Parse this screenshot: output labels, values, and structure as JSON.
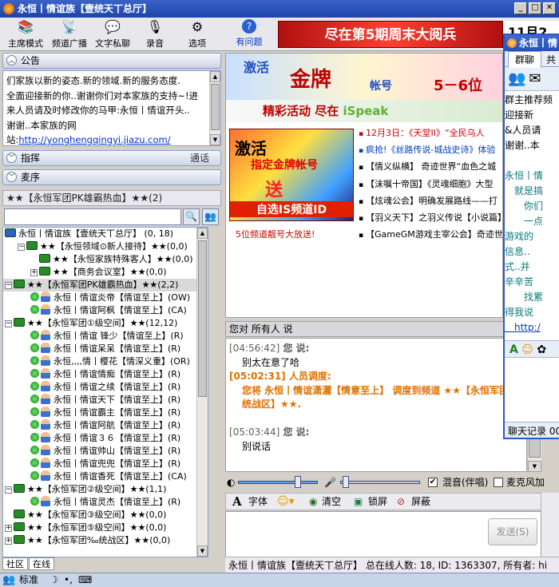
{
  "window": {
    "title": "永恒丨情谊族【壹统天丅总厅】"
  },
  "toolbar": {
    "items": [
      {
        "label": "主席模式",
        "icon": "chair-icon"
      },
      {
        "label": "频道广播",
        "icon": "broadcast-icon"
      },
      {
        "label": "文字私聊",
        "icon": "private-chat-icon"
      },
      {
        "label": "录音",
        "icon": "record-icon"
      },
      {
        "label": "选项",
        "icon": "gear-icon"
      },
      {
        "label": "有问题",
        "icon": "help-icon"
      }
    ]
  },
  "banner_top": {
    "text": "尽在第5期周末大阅兵",
    "date": "11月2"
  },
  "notice": {
    "header": "公告",
    "lines": [
      "们家族以新的姿态.新的领域.新的服务态度.",
      "全面迎接新的你..谢谢你们对本家族的支持~!进",
      "来人员请及时修改你的马甲:永恒丨情谊开头..",
      "谢谢..本家族的网"
    ],
    "site_label": "站:",
    "url": "http://yonghengqingyi.jiazu.com/"
  },
  "panels": {
    "guide": "指挥",
    "guide_right": "通话",
    "wheat": "麦序"
  },
  "channel_title": "★★【永恒军团PK雄霸热血】★★(2)",
  "tree": [
    {
      "t": "永恒丨情谊族【壹统天丅总厅】 (0, 18)",
      "type": "root",
      "indent": 0,
      "exp": ""
    },
    {
      "t": "★★【永恒领域⊙新人接待】★★(0,0)",
      "type": "chan",
      "indent": 1,
      "exp": "−"
    },
    {
      "t": "★★【永恒家族特殊客人】★★(0,0)",
      "type": "chan",
      "indent": 2,
      "exp": ""
    },
    {
      "t": "★★【商务会议室】★★(0,0)",
      "type": "chan",
      "indent": 2,
      "exp": "+"
    },
    {
      "t": "★★【永恒军团PK雄霸热血】★★(2,2)",
      "type": "chan",
      "indent": 0,
      "exp": "−",
      "sel": true
    },
    {
      "t": "永恒丨情谊炎帝【情谊至上】(OW)",
      "type": "user",
      "indent": 2
    },
    {
      "t": "永恒丨情谊阿枫【情谊至上】(CA)",
      "type": "user",
      "indent": 2
    },
    {
      "t": "★★【永恒军团①级空间】★★(12,12)",
      "type": "chan",
      "indent": 0,
      "exp": "−"
    },
    {
      "t": "永恒丨情谊 锋少【情谊至上】(R)",
      "type": "user",
      "indent": 2
    },
    {
      "t": "永恒丨情谊呆呆【情谊至上】(R)",
      "type": "user",
      "indent": 2
    },
    {
      "t": "永恒,,,,情丨樱花【情深义重】(OR)",
      "type": "user",
      "indent": 2
    },
    {
      "t": "永恒丨情谊情痴【情谊至上】(R)",
      "type": "user",
      "indent": 2
    },
    {
      "t": "永恒丨情谊之续【情谊至上】(R)",
      "type": "user",
      "indent": 2
    },
    {
      "t": "永恒丨情谊天下【情谊至上】(R)",
      "type": "user",
      "indent": 2
    },
    {
      "t": "永恒丨情谊霸主【情谊至上】(R)",
      "type": "user",
      "indent": 2
    },
    {
      "t": "永恒丨情谊阿航【情谊至上】(R)",
      "type": "user",
      "indent": 2
    },
    {
      "t": "永恒丨情谊３６【情谊至上】(R)",
      "type": "user",
      "indent": 2
    },
    {
      "t": "永恒丨情谊帅山【情谊至上】(R)",
      "type": "user",
      "indent": 2
    },
    {
      "t": "永恒丨情谊兜兜【情谊至上】(R)",
      "type": "user",
      "indent": 2
    },
    {
      "t": "永恒丨情谊香死【情谊至上】(CA)",
      "type": "user",
      "indent": 2
    },
    {
      "t": "★★【永恒军团②级空间】★★(1,1)",
      "type": "chan",
      "indent": 0,
      "exp": "−"
    },
    {
      "t": "永恒丨情谊灵杰【情谊至上】(R)",
      "type": "user",
      "indent": 2
    },
    {
      "t": "★★【永恒军团③级空间】★★(0,0)",
      "type": "chan",
      "indent": 0,
      "exp": ""
    },
    {
      "t": "★★【永恒军团⑤级空间】★★(0,0)",
      "type": "chan",
      "indent": 0,
      "exp": "+"
    },
    {
      "t": "★★【永恒军团‰统战区】★★(0,0)",
      "type": "chan",
      "indent": 0,
      "exp": "+"
    }
  ],
  "bottom_tabs": [
    "社区",
    "在线"
  ],
  "status_left": "标准",
  "ad": {
    "banner": [
      "激活",
      "金牌",
      "帐号",
      "5－6位"
    ],
    "strip_a": "精彩活动 尽在 ",
    "strip_b": "iSpeak",
    "img": [
      "激活",
      "指定金牌帐号",
      "送",
      "自选IS频道ID"
    ],
    "red_caption": "5位频道靓号大放送!",
    "news": [
      {
        "t": "12月3日：《天堂II》“全民乌人",
        "c": "red"
      },
      {
        "t": "疯抢!《丝路传说-城战史诗》体验",
        "c": "blue"
      },
      {
        "t": "【情义纵横】 奇迹世界“血色之城",
        "c": ""
      },
      {
        "t": "【沫嘱十帝国】《灵魂细胞》大型",
        "c": ""
      },
      {
        "t": "【炫魂公会】明确发展路线——打",
        "c": ""
      },
      {
        "t": "【羽义天下】之羽义传说【小说篇】",
        "c": ""
      },
      {
        "t": "【GameGM游戏主宰公会】奇迹世界",
        "c": ""
      }
    ]
  },
  "chat": {
    "header": "您对 所有人 说",
    "lines": [
      {
        "ts": "[04:56:42]",
        "who": " 您 说:",
        "msg": "别太在意了哈",
        "kind": "normal"
      },
      {
        "ts": "[05:02:31]",
        "who": " 人员调度:",
        "msg": "您将 永恒丨情谊潇灑【情意至上】 调度到频道 ★★【永恒军团‰统战区】★★.",
        "kind": "sys"
      },
      {
        "ts": "[05:03:44]",
        "who": " 您 说:",
        "msg": "别说话",
        "kind": "normal"
      }
    ]
  },
  "audio": {
    "mix_label": "混音(伴唱)",
    "mic_label": "麦克风加",
    "mix_checked": true,
    "mic_checked": false,
    "volume": 0.75,
    "mic_level": 0.03
  },
  "format": {
    "font": "字体",
    "clear": "清空",
    "lock": "锁屏",
    "block": "屏蔽"
  },
  "send": "发送(S)",
  "info": "永恒丨情谊族【壹统天丅总厅】 总在线人数: 18, ID: 1363307, 所有者: hi",
  "floatwin": {
    "title": "永恒丨情",
    "tabs": [
      "群聊",
      "共"
    ],
    "text": [
      {
        "t": "群主推荐频",
        "c": ""
      },
      {
        "t": "迎接新",
        "c": ""
      },
      {
        "t": "&人员请",
        "c": ""
      },
      {
        "t": "谢谢..本",
        "c": ""
      },
      {
        "t": "",
        "c": ""
      },
      {
        "t": "永恒丨情",
        "c": "teal"
      },
      {
        "t": "　就是搞",
        "c": "teal"
      },
      {
        "t": "　　你们",
        "c": "teal"
      },
      {
        "t": "　　一点",
        "c": "teal"
      },
      {
        "t": "游戏的",
        "c": "teal"
      },
      {
        "t": "信息..",
        "c": "teal"
      },
      {
        "t": "式..并",
        "c": "teal"
      },
      {
        "t": "辛辛苦",
        "c": "teal"
      },
      {
        "t": "　　找累",
        "c": "teal"
      },
      {
        "t": "得我说",
        "c": "teal"
      },
      {
        "t": "　http:/",
        "c": "link"
      }
    ],
    "history": "聊天记录 00"
  }
}
